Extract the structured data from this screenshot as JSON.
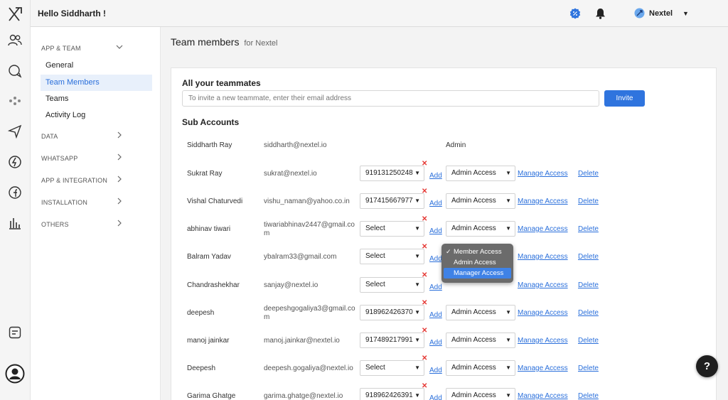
{
  "header": {
    "greeting": "Hello Siddharth !",
    "workspace": "Nextel"
  },
  "sidenav": {
    "sections": [
      {
        "label": "APP & TEAM",
        "expanded": true,
        "items": [
          "General",
          "Team Members",
          "Teams",
          "Activity Log"
        ],
        "active": "Team Members"
      },
      {
        "label": "DATA"
      },
      {
        "label": "WHATSAPP"
      },
      {
        "label": "APP & INTEGRATION"
      },
      {
        "label": "INSTALLATION"
      },
      {
        "label": "OTHERS"
      }
    ]
  },
  "page": {
    "title": "Team members",
    "subtitle": "for Nextel"
  },
  "invite": {
    "heading": "All your teammates",
    "placeholder": "To invite a new teammate, enter their email address",
    "button": "Invite"
  },
  "sub_accounts": {
    "heading": "Sub Accounts",
    "add_label": "Add",
    "manage_label": "Manage Access",
    "delete_label": "Delete",
    "owner": {
      "name": "Siddharth Ray",
      "email": "siddharth@nextel.io",
      "role": "Admin"
    },
    "rows": [
      {
        "name": "Sukrat Ray",
        "email": "sukrat@nextel.io",
        "phone": "919131250248",
        "access": "Admin Access"
      },
      {
        "name": "Vishal Chaturvedi",
        "email": "vishu_naman@yahoo.co.in",
        "phone": "917415667977",
        "access": "Admin Access"
      },
      {
        "name": "abhinav tiwari",
        "email": "tiwariabhinav2447@gmail.com",
        "phone": "Select",
        "access": "Admin Access"
      },
      {
        "name": "Balram Yadav",
        "email": "ybalram33@gmail.com",
        "phone": "Select",
        "access": "Member Access"
      },
      {
        "name": "Chandrashekhar",
        "email": "sanjay@nextel.io",
        "phone": "Select",
        "access": "Manager Access"
      },
      {
        "name": "deepesh",
        "email": "deepeshgogaliya3@gmail.com",
        "phone": "918962426370",
        "access": "Admin Access"
      },
      {
        "name": "manoj jainkar",
        "email": "manoj.jainkar@nextel.io",
        "phone": "917489217991",
        "access": "Admin Access"
      },
      {
        "name": "Deepesh",
        "email": "deepesh.gogaliya@nextel.io",
        "phone": "Select",
        "access": "Admin Access"
      },
      {
        "name": "Garima Ghatge",
        "email": "garima.ghatge@nextel.io",
        "phone": "918962426391",
        "access": "Admin Access"
      }
    ]
  },
  "access_menu": {
    "options": [
      "Member Access",
      "Admin Access",
      "Manager Access"
    ],
    "checked": "Member Access",
    "highlighted": "Manager Access"
  },
  "help": {
    "label": "?"
  },
  "colors": {
    "accent": "#2f74de",
    "delete_x": "#e53935"
  }
}
